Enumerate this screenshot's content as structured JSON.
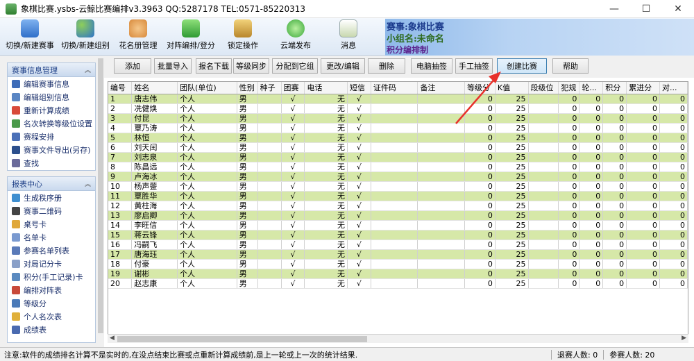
{
  "window": {
    "title": "象棋比赛.ysbs-云鲸比赛编排v3.3963 QQ:5287178 TEL:0571-85220313",
    "minimize": "—",
    "maximize": "☐",
    "close": "✕"
  },
  "toolbar": {
    "buttons": [
      {
        "label": "切换/新建赛事",
        "icon": "trophy-icon"
      },
      {
        "label": "切换/新建组别",
        "icon": "group-icon"
      },
      {
        "label": "花名册管理",
        "icon": "people-icon"
      },
      {
        "label": "对阵编排/登分",
        "icon": "vs-icon"
      },
      {
        "label": "锁定操作",
        "icon": "key-icon"
      },
      {
        "label": "云端发布",
        "icon": "cloud-icon"
      },
      {
        "label": "消息",
        "icon": "envelope-icon"
      }
    ],
    "info": {
      "event": "赛事:象棋比赛",
      "group": "小组名:未命名",
      "mode": "积分编排制"
    }
  },
  "sidebar": {
    "panel1": {
      "title": "赛事信息管理",
      "items": [
        {
          "label": "编辑赛事信息"
        },
        {
          "label": "编辑组别信息"
        },
        {
          "label": "重新计算成绩"
        },
        {
          "label": "名次转换等级位设置"
        },
        {
          "label": "赛程安排"
        },
        {
          "label": "赛事文件导出(另存)"
        },
        {
          "label": "查找"
        }
      ]
    },
    "panel2": {
      "title": "报表中心",
      "items": [
        {
          "label": "生成秩序册"
        },
        {
          "label": "赛事二维码"
        },
        {
          "label": "桌号卡"
        },
        {
          "label": "名单卡"
        },
        {
          "label": "参赛名单列表"
        },
        {
          "label": "对局记分卡"
        },
        {
          "label": "积分(手工记录)卡"
        },
        {
          "label": "编排对阵表"
        },
        {
          "label": "等级分"
        },
        {
          "label": "个人名次表"
        },
        {
          "label": "成绩表"
        }
      ]
    }
  },
  "actions": {
    "buttons": [
      "添加",
      "批量导入",
      "报名下载",
      "等级同步",
      "分配到它组",
      "更改/编辑",
      "删除",
      "电脑抽签",
      "手工抽签",
      "创建比赛",
      "帮助"
    ]
  },
  "table": {
    "headers": [
      "编号",
      "姓名",
      "团队(单位)",
      "性别",
      "种子",
      "团赛",
      "电话",
      "短信",
      "证件码",
      "备注",
      "等级分",
      "K值",
      "段级位",
      "犯规",
      "轮...",
      "积分",
      "累进分",
      "对..."
    ],
    "rows": [
      [
        "1",
        "唐志伟",
        "个人",
        "男",
        "",
        "√",
        "无",
        "√",
        "",
        "",
        "0",
        "25",
        "",
        "0",
        "0",
        "0",
        "0",
        "0"
      ],
      [
        "2",
        "冼健焕",
        "个人",
        "男",
        "",
        "√",
        "无",
        "√",
        "",
        "",
        "0",
        "25",
        "",
        "0",
        "0",
        "0",
        "0",
        "0"
      ],
      [
        "3",
        "付昆",
        "个人",
        "男",
        "",
        "√",
        "无",
        "√",
        "",
        "",
        "0",
        "25",
        "",
        "0",
        "0",
        "0",
        "0",
        "0"
      ],
      [
        "4",
        "覃乃涛",
        "个人",
        "男",
        "",
        "√",
        "无",
        "√",
        "",
        "",
        "0",
        "25",
        "",
        "0",
        "0",
        "0",
        "0",
        "0"
      ],
      [
        "5",
        "林恒",
        "个人",
        "男",
        "",
        "√",
        "无",
        "√",
        "",
        "",
        "0",
        "25",
        "",
        "0",
        "0",
        "0",
        "0",
        "0"
      ],
      [
        "6",
        "刘天闰",
        "个人",
        "男",
        "",
        "√",
        "无",
        "√",
        "",
        "",
        "0",
        "25",
        "",
        "0",
        "0",
        "0",
        "0",
        "0"
      ],
      [
        "7",
        "刘志泉",
        "个人",
        "男",
        "",
        "√",
        "无",
        "√",
        "",
        "",
        "0",
        "25",
        "",
        "0",
        "0",
        "0",
        "0",
        "0"
      ],
      [
        "8",
        "陈昌远",
        "个人",
        "男",
        "",
        "√",
        "无",
        "√",
        "",
        "",
        "0",
        "25",
        "",
        "0",
        "0",
        "0",
        "0",
        "0"
      ],
      [
        "9",
        "卢海冰",
        "个人",
        "男",
        "",
        "√",
        "无",
        "√",
        "",
        "",
        "0",
        "25",
        "",
        "0",
        "0",
        "0",
        "0",
        "0"
      ],
      [
        "10",
        "杨声蓥",
        "个人",
        "男",
        "",
        "√",
        "无",
        "√",
        "",
        "",
        "0",
        "25",
        "",
        "0",
        "0",
        "0",
        "0",
        "0"
      ],
      [
        "11",
        "覃胜华",
        "个人",
        "男",
        "",
        "√",
        "无",
        "√",
        "",
        "",
        "0",
        "25",
        "",
        "0",
        "0",
        "0",
        "0",
        "0"
      ],
      [
        "12",
        "黄柱海",
        "个人",
        "男",
        "",
        "√",
        "无",
        "√",
        "",
        "",
        "0",
        "25",
        "",
        "0",
        "0",
        "0",
        "0",
        "0"
      ],
      [
        "13",
        "廖启卿",
        "个人",
        "男",
        "",
        "√",
        "无",
        "√",
        "",
        "",
        "0",
        "25",
        "",
        "0",
        "0",
        "0",
        "0",
        "0"
      ],
      [
        "14",
        "李旺信",
        "个人",
        "男",
        "",
        "√",
        "无",
        "√",
        "",
        "",
        "0",
        "25",
        "",
        "0",
        "0",
        "0",
        "0",
        "0"
      ],
      [
        "15",
        "蒋云锋",
        "个人",
        "男",
        "",
        "√",
        "无",
        "√",
        "",
        "",
        "0",
        "25",
        "",
        "0",
        "0",
        "0",
        "0",
        "0"
      ],
      [
        "16",
        "冯嗣飞",
        "个人",
        "男",
        "",
        "√",
        "无",
        "√",
        "",
        "",
        "0",
        "25",
        "",
        "0",
        "0",
        "0",
        "0",
        "0"
      ],
      [
        "17",
        "唐海珏",
        "个人",
        "男",
        "",
        "√",
        "无",
        "√",
        "",
        "",
        "0",
        "25",
        "",
        "0",
        "0",
        "0",
        "0",
        "0"
      ],
      [
        "18",
        "付豪",
        "个人",
        "男",
        "",
        "√",
        "无",
        "√",
        "",
        "",
        "0",
        "25",
        "",
        "0",
        "0",
        "0",
        "0",
        "0"
      ],
      [
        "19",
        "谢彬",
        "个人",
        "男",
        "",
        "√",
        "无",
        "√",
        "",
        "",
        "0",
        "25",
        "",
        "0",
        "0",
        "0",
        "0",
        "0"
      ],
      [
        "20",
        "赵志康",
        "个人",
        "男",
        "",
        "√",
        "无",
        "√",
        "",
        "",
        "0",
        "25",
        "",
        "0",
        "0",
        "0",
        "0",
        "0"
      ]
    ]
  },
  "status": {
    "message": "注意:软件的成绩排名计算不是实时的,在没点结束比赛或点重新计算成绩前,是上一轮或上一次的统计结果.",
    "withdrawn": "退赛人数: 0",
    "participants": "参赛人数: 20"
  },
  "colors": {
    "row_highlight": "#d6e8a8",
    "annotation_arrow": "#e8312b"
  }
}
